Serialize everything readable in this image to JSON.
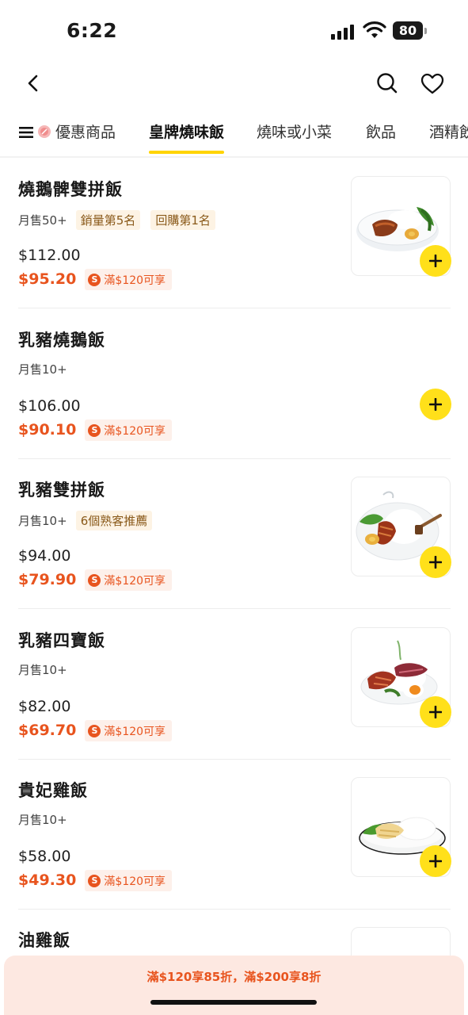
{
  "status_bar": {
    "time": "6:22",
    "battery": "80"
  },
  "tabs": [
    {
      "label": "優惠商品"
    },
    {
      "label": "皇牌燒味飯"
    },
    {
      "label": "燒味或小菜"
    },
    {
      "label": "飲品"
    },
    {
      "label": "酒精飲"
    }
  ],
  "active_tab": "皇牌燒味飯",
  "items": [
    {
      "name": "燒鵝髀雙拼飯",
      "sales": "月售50+",
      "tags": [
        "銷量第5名",
        "回購第1名"
      ],
      "original_price": "$112.00",
      "price": "$95.20",
      "promo": "滿$120可享",
      "promo_icon": "S",
      "image": "roast-goose-leg-rice-photo"
    },
    {
      "name": "乳豬燒鵝飯",
      "sales": "月售10+",
      "tags": [],
      "original_price": "$106.00",
      "price": "$90.10",
      "promo": "滿$120可享",
      "promo_icon": "S",
      "image": null
    },
    {
      "name": "乳豬雙拼飯",
      "sales": "月售10+",
      "tags": [
        "6個熟客推薦"
      ],
      "original_price": "$94.00",
      "price": "$79.90",
      "promo": "滿$120可享",
      "promo_icon": "S",
      "image": "suckling-pig-combo-rice-photo"
    },
    {
      "name": "乳豬四寶飯",
      "sales": "月售10+",
      "tags": [],
      "original_price": "$82.00",
      "price": "$69.70",
      "promo": "滿$120可享",
      "promo_icon": "S",
      "image": "suckling-pig-four-treasures-rice-photo"
    },
    {
      "name": "貴妃雞飯",
      "sales": "月售10+",
      "tags": [],
      "original_price": "$58.00",
      "price": "$49.30",
      "promo": "滿$120可享",
      "promo_icon": "S",
      "image": "chicken-rice-photo"
    },
    {
      "name": "油雞飯"
    }
  ],
  "banner": {
    "text": "滿$120享85折，滿$200享8折"
  },
  "colors": {
    "accent": "#ffd400",
    "add_button": "#ffe01a",
    "price": "#e8541e",
    "banner_bg": "#fde8e1",
    "tag_text": "#8a5a1a",
    "tag_bg": "#fdf3e4"
  }
}
